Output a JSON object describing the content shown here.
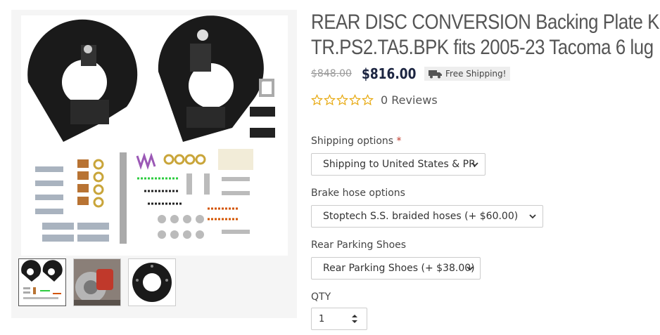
{
  "gallery": {
    "main_image_alt": "rear disc conversion backing plate kit parts",
    "thumbnails": [
      {
        "name": "thumb-parts-kit",
        "active": true
      },
      {
        "name": "thumb-red-caliper",
        "active": false
      },
      {
        "name": "thumb-backing-plate",
        "active": false
      }
    ]
  },
  "product": {
    "title_line1": "REAR DISC CONVERSION Backing Plate Kit /",
    "title_line2": "TR.PS2.TA5.BPK fits 2005-23 Tacoma 6 lug",
    "old_price": "$848.00",
    "price": "$816.00",
    "shipping_badge": "Free Shipping!",
    "reviews": "0 Reviews",
    "rating": 0,
    "rating_max": 5
  },
  "options": {
    "shipping_label": "Shipping options",
    "required_mark": "*",
    "shipping_value": "Shipping to United States & PR",
    "brake_hose_label": "Brake hose options",
    "brake_hose_value": "Stoptech S.S. braided hoses (+ $60.00)",
    "parking_label": "Rear Parking Shoes",
    "parking_value": "Rear Parking Shoes (+ $38.00)",
    "qty_label": "QTY",
    "qty_value": "1"
  },
  "colors": {
    "price": "#1c2541",
    "star": "#e6a400",
    "required": "#c0392b"
  },
  "icons": [
    "truck-icon",
    "star-outline-icon",
    "chevron-down-icon",
    "spinner-icon"
  ]
}
